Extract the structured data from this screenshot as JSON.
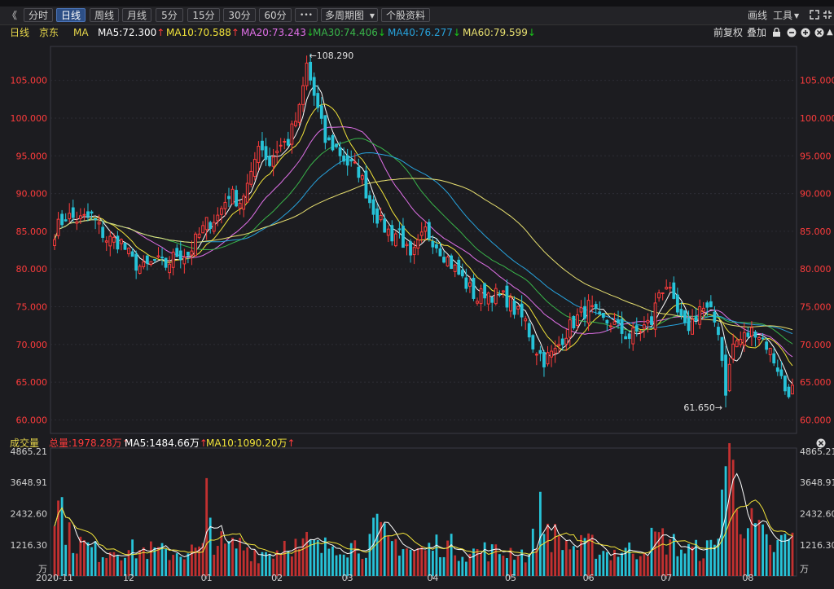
{
  "toolbar": {
    "collapse_glyph": "《",
    "periods": [
      {
        "label": "分时",
        "active": false
      },
      {
        "label": "日线",
        "active": true
      },
      {
        "label": "周线",
        "active": false
      },
      {
        "label": "月线",
        "active": false
      },
      {
        "label": "5分",
        "active": false
      },
      {
        "label": "15分",
        "active": false
      },
      {
        "label": "30分",
        "active": false
      },
      {
        "label": "60分",
        "active": false
      }
    ],
    "more_label": "•••",
    "multi_period_label": "多周期图",
    "stock_info_label": "个股资料",
    "draw_label": "画线",
    "tools_label": "工具",
    "tools_arrow": "▼"
  },
  "ma_bar": {
    "period": "日线",
    "stock": "京东",
    "indicator": "MA",
    "items": [
      {
        "label": "MA5:72.300",
        "dir": "up",
        "color": "#ffffff"
      },
      {
        "label": "MA10:70.588",
        "dir": "up",
        "color": "#f2e43a"
      },
      {
        "label": "MA20:73.243",
        "dir": "down",
        "color": "#e070e8"
      },
      {
        "label": "MA30:74.406",
        "dir": "down",
        "color": "#39b54a"
      },
      {
        "label": "MA40:76.277",
        "dir": "down",
        "color": "#27a3dd"
      },
      {
        "label": "MA60:79.599",
        "dir": "down",
        "color": "#e8e070"
      }
    ],
    "adjust_label": "前复权",
    "overlay_label": "叠加"
  },
  "volume_bar": {
    "title": "成交量",
    "total": "总量:1978.28万",
    "ma5": "MA5:1484.66万",
    "ma10": "MA10:1090.20万"
  },
  "chart_data": {
    "type": "candlestick",
    "price_axis": {
      "ticks": [
        "60.000",
        "65.000",
        "70.000",
        "75.000",
        "80.000",
        "85.000",
        "90.000",
        "95.000",
        "100.000",
        "105.000"
      ],
      "ylim": [
        59.5,
        109.5
      ]
    },
    "volume_axis": {
      "ticks": [
        "1216.30",
        "2432.60",
        "3648.91",
        "4865.21"
      ],
      "unit": "万",
      "ylim": [
        0,
        4865.21
      ]
    },
    "x_labels": [
      {
        "label": "2020-11",
        "index": 0
      },
      {
        "label": "12",
        "index": 20
      },
      {
        "label": "01",
        "index": 41
      },
      {
        "label": "02",
        "index": 60
      },
      {
        "label": "03",
        "index": 79
      },
      {
        "label": "04",
        "index": 102
      },
      {
        "label": "05",
        "index": 123
      },
      {
        "label": "06",
        "index": 144
      },
      {
        "label": "07",
        "index": 165
      },
      {
        "label": "08",
        "index": 187
      }
    ],
    "annotations": [
      {
        "label": "108.290",
        "kind": "high",
        "index": 68,
        "value": 108.29
      },
      {
        "label": "61.650",
        "kind": "low",
        "index": 181,
        "value": 61.65
      }
    ],
    "ma_series_colors": {
      "MA5": "#ffffff",
      "MA10": "#f2e43a",
      "MA20": "#e070e8",
      "MA30": "#39b54a",
      "MA40": "#27a3dd",
      "MA60": "#e8e070"
    },
    "close_anchors": [
      [
        0,
        85
      ],
      [
        3,
        87
      ],
      [
        7,
        86.5
      ],
      [
        10,
        87
      ],
      [
        14,
        84
      ],
      [
        18,
        83.5
      ],
      [
        21,
        81
      ],
      [
        24,
        80
      ],
      [
        27,
        81
      ],
      [
        30,
        80.5
      ],
      [
        33,
        82
      ],
      [
        36,
        82
      ],
      [
        39,
        84.5
      ],
      [
        41,
        86
      ],
      [
        44,
        87
      ],
      [
        47,
        90
      ],
      [
        50,
        89
      ],
      [
        53,
        92
      ],
      [
        55,
        97
      ],
      [
        58,
        94
      ],
      [
        60,
        96
      ],
      [
        63,
        97
      ],
      [
        66,
        101
      ],
      [
        68,
        107
      ],
      [
        71,
        101
      ],
      [
        73,
        97
      ],
      [
        76,
        96
      ],
      [
        79,
        94
      ],
      [
        82,
        93
      ],
      [
        85,
        89
      ],
      [
        88,
        86
      ],
      [
        91,
        84.5
      ],
      [
        93,
        85
      ],
      [
        96,
        81
      ],
      [
        98,
        83
      ],
      [
        100,
        85
      ],
      [
        102,
        84
      ],
      [
        105,
        82
      ],
      [
        108,
        80
      ],
      [
        111,
        78
      ],
      [
        114,
        76
      ],
      [
        116,
        77
      ],
      [
        119,
        76.5
      ],
      [
        122,
        76
      ],
      [
        125,
        74
      ],
      [
        127,
        73
      ],
      [
        129,
        70
      ],
      [
        132,
        68
      ],
      [
        135,
        69
      ],
      [
        137,
        71
      ],
      [
        140,
        73
      ],
      [
        142,
        74
      ],
      [
        144,
        75
      ],
      [
        147,
        73
      ],
      [
        150,
        73
      ],
      [
        152,
        72
      ],
      [
        155,
        71
      ],
      [
        158,
        72
      ],
      [
        161,
        73
      ],
      [
        163,
        77
      ],
      [
        165,
        78
      ],
      [
        167,
        75
      ],
      [
        170,
        72
      ],
      [
        172,
        73
      ],
      [
        174,
        75
      ],
      [
        177,
        74
      ],
      [
        179,
        72
      ],
      [
        181,
        64
      ],
      [
        183,
        70
      ],
      [
        186,
        71
      ],
      [
        189,
        72
      ],
      [
        192,
        70
      ],
      [
        195,
        67
      ],
      [
        197,
        64
      ],
      [
        199,
        64
      ]
    ],
    "volume_anchors": [
      [
        0,
        2600
      ],
      [
        2,
        2700
      ],
      [
        4,
        1500
      ],
      [
        8,
        1200
      ],
      [
        12,
        900
      ],
      [
        16,
        1100
      ],
      [
        20,
        1000
      ],
      [
        25,
        1000
      ],
      [
        30,
        900
      ],
      [
        35,
        950
      ],
      [
        40,
        1000
      ],
      [
        41,
        2900
      ],
      [
        43,
        1500
      ],
      [
        46,
        1100
      ],
      [
        50,
        1200
      ],
      [
        55,
        900
      ],
      [
        60,
        1000
      ],
      [
        63,
        1500
      ],
      [
        66,
        1000
      ],
      [
        68,
        1300
      ],
      [
        72,
        1000
      ],
      [
        76,
        1400
      ],
      [
        80,
        1200
      ],
      [
        84,
        1200
      ],
      [
        87,
        1800
      ],
      [
        90,
        1300
      ],
      [
        93,
        1300
      ],
      [
        96,
        1000
      ],
      [
        100,
        1000
      ],
      [
        104,
        1300
      ],
      [
        108,
        1100
      ],
      [
        112,
        900
      ],
      [
        116,
        1000
      ],
      [
        120,
        900
      ],
      [
        124,
        1000
      ],
      [
        128,
        800
      ],
      [
        131,
        2400
      ],
      [
        134,
        1600
      ],
      [
        137,
        1300
      ],
      [
        141,
        1100
      ],
      [
        145,
        1200
      ],
      [
        149,
        900
      ],
      [
        153,
        1000
      ],
      [
        157,
        1000
      ],
      [
        160,
        1300
      ],
      [
        163,
        1500
      ],
      [
        166,
        1300
      ],
      [
        170,
        1000
      ],
      [
        174,
        1000
      ],
      [
        178,
        1100
      ],
      [
        181,
        4500
      ],
      [
        183,
        4000
      ],
      [
        185,
        2600
      ],
      [
        187,
        2000
      ],
      [
        190,
        1700
      ],
      [
        193,
        1000
      ],
      [
        196,
        1300
      ],
      [
        199,
        1500
      ]
    ]
  }
}
